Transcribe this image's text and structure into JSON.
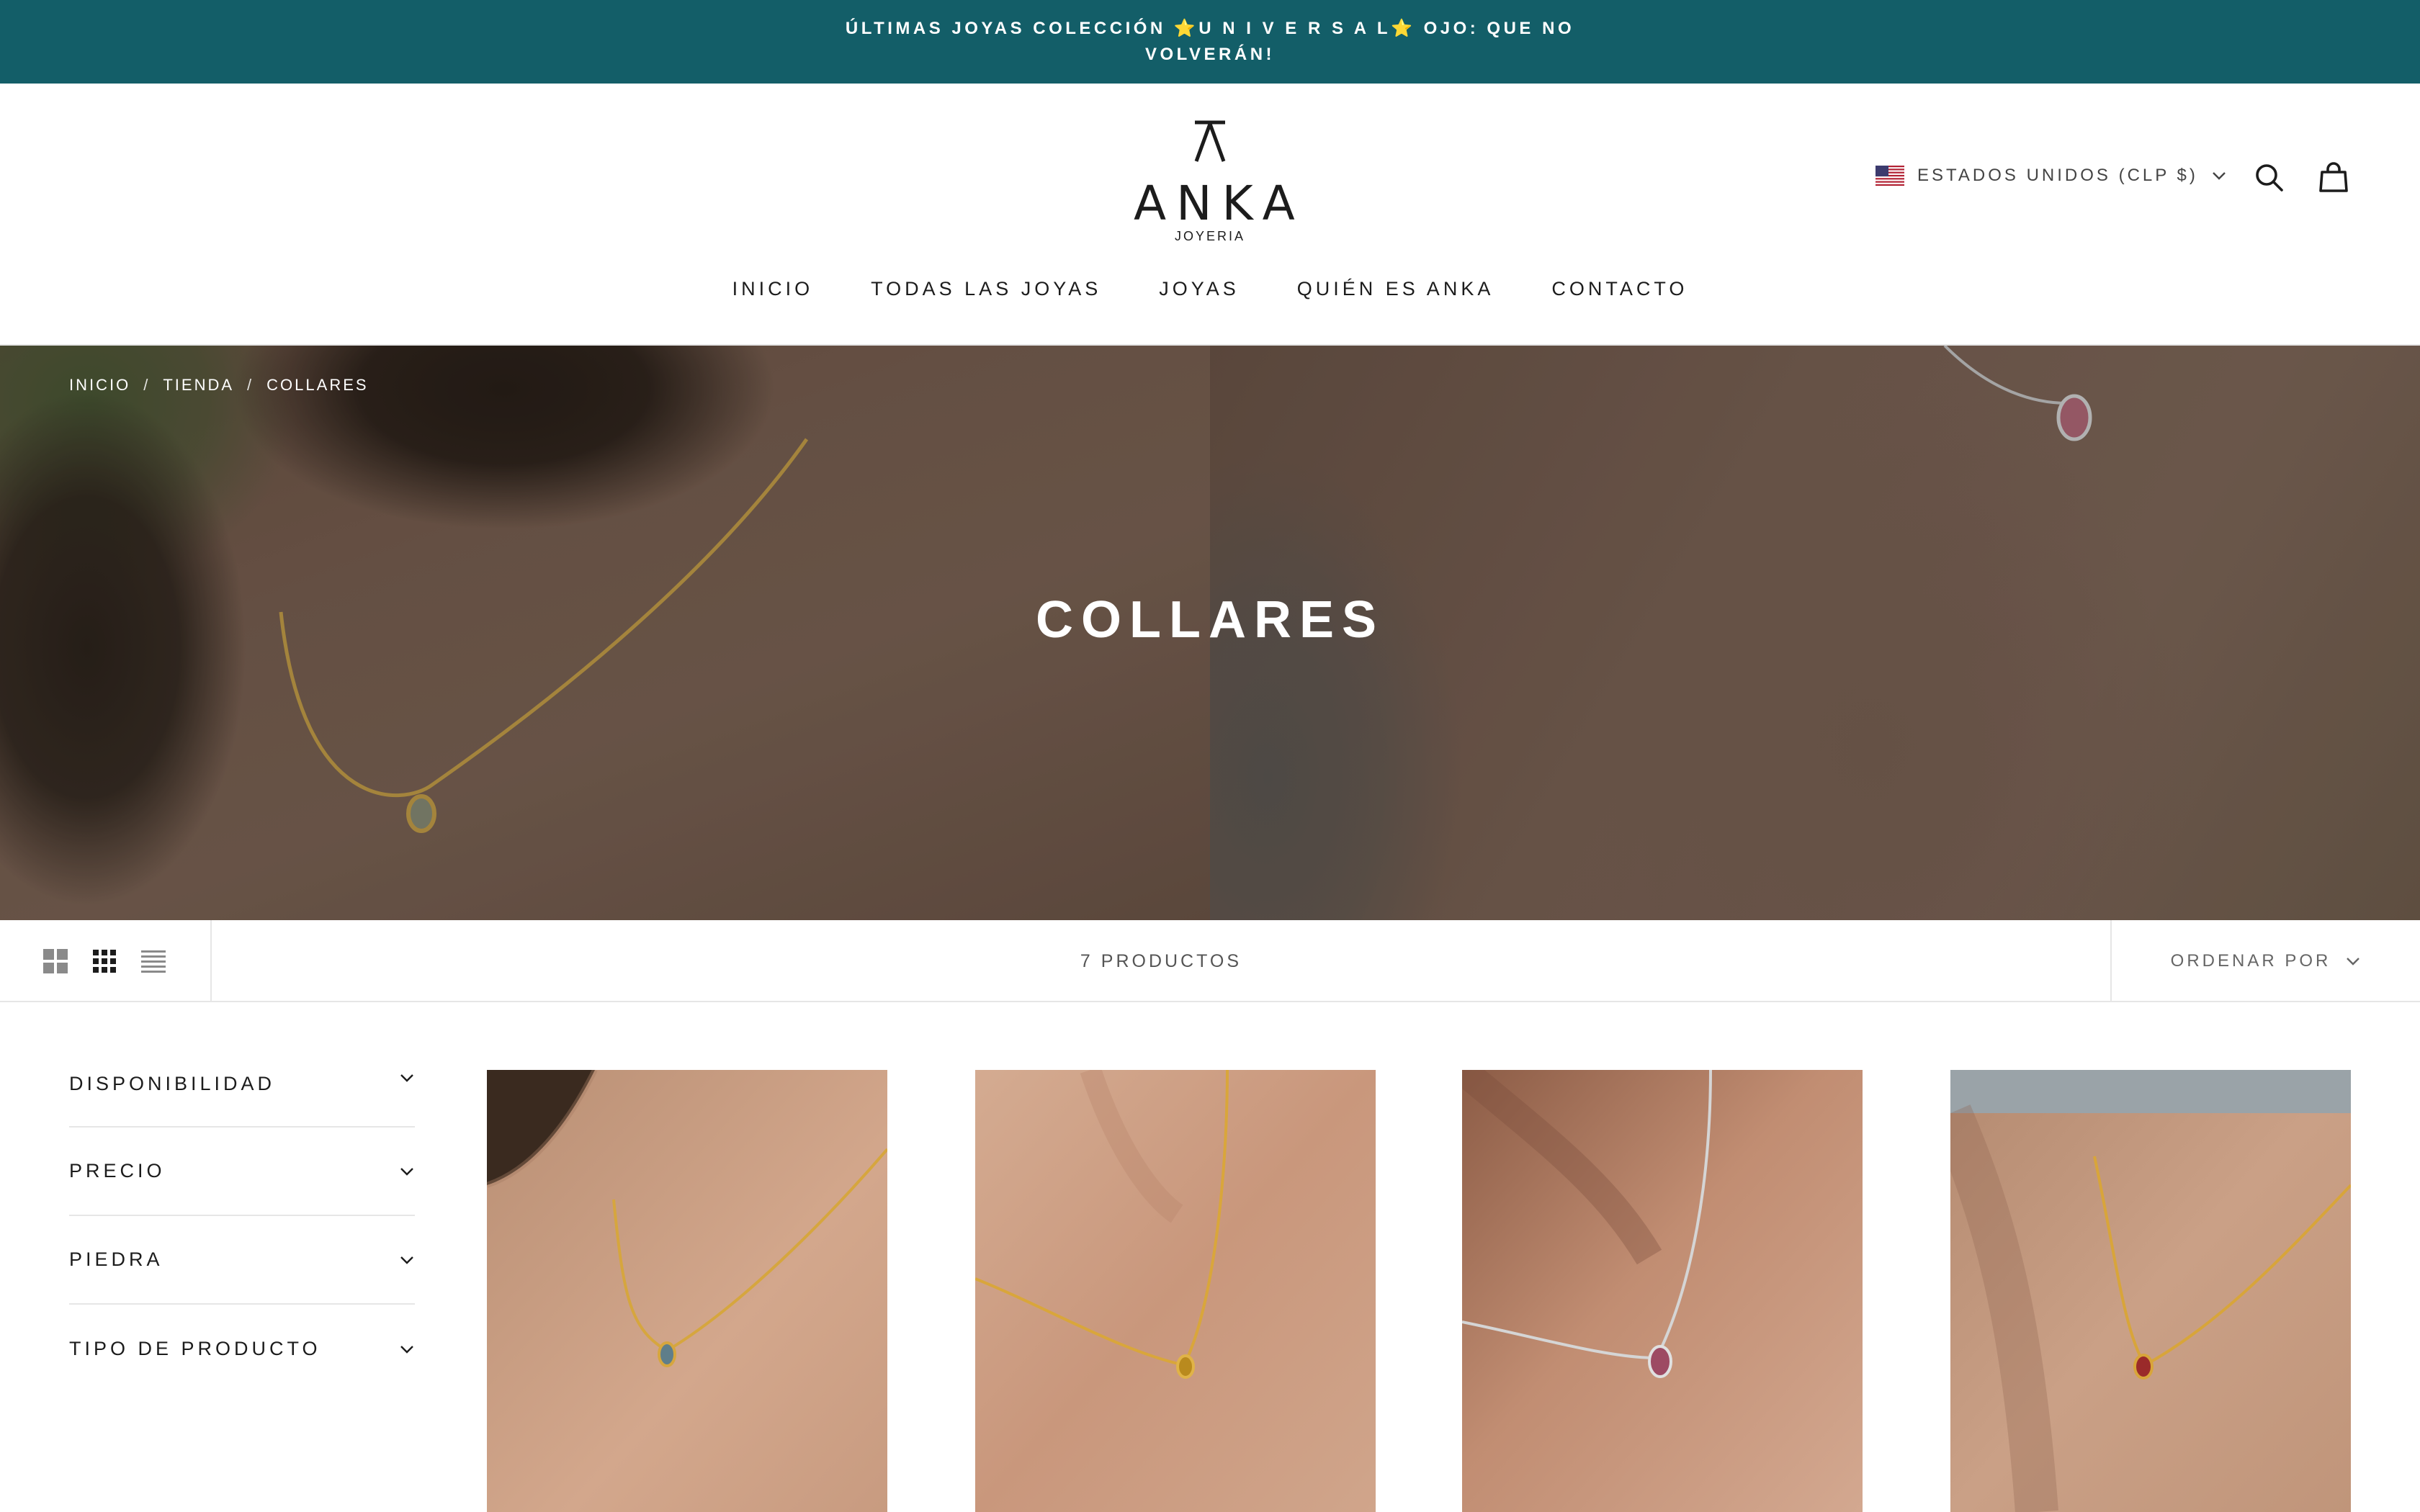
{
  "announcement": {
    "text": "Últimas joyas colección ⭐U N I V E R S A L⭐ OJO: QUE NO VOLVERÁN!"
  },
  "header": {
    "logo": {
      "wordmark": "ANKA",
      "subtitle": "JOYERIA"
    },
    "country_selector": {
      "label": "Estados Unidos (CLP $)",
      "flag_icon": "us-flag-icon"
    },
    "icons": [
      "search-icon",
      "shopping-bag-icon"
    ],
    "nav": [
      "Inicio",
      "Todas las joyas",
      "Joyas",
      "Quién es Anka",
      "Contacto"
    ]
  },
  "hero": {
    "breadcrumb": [
      "Inicio",
      "Tienda",
      "Collares"
    ],
    "breadcrumb_separator": "/",
    "title": "Collares"
  },
  "toolbar": {
    "layout_icons": [
      "grid-large-icon",
      "grid-small-icon",
      "list-icon"
    ],
    "product_count": "7 productos",
    "sort_label": "Ordenar por"
  },
  "filters": [
    "Disponibilidad",
    "Precio",
    "Piedra",
    "Tipo de producto"
  ],
  "colors": {
    "announcement_bg": "#135e68",
    "text": "#1c1c1c",
    "divider": "#e6e6e6"
  }
}
